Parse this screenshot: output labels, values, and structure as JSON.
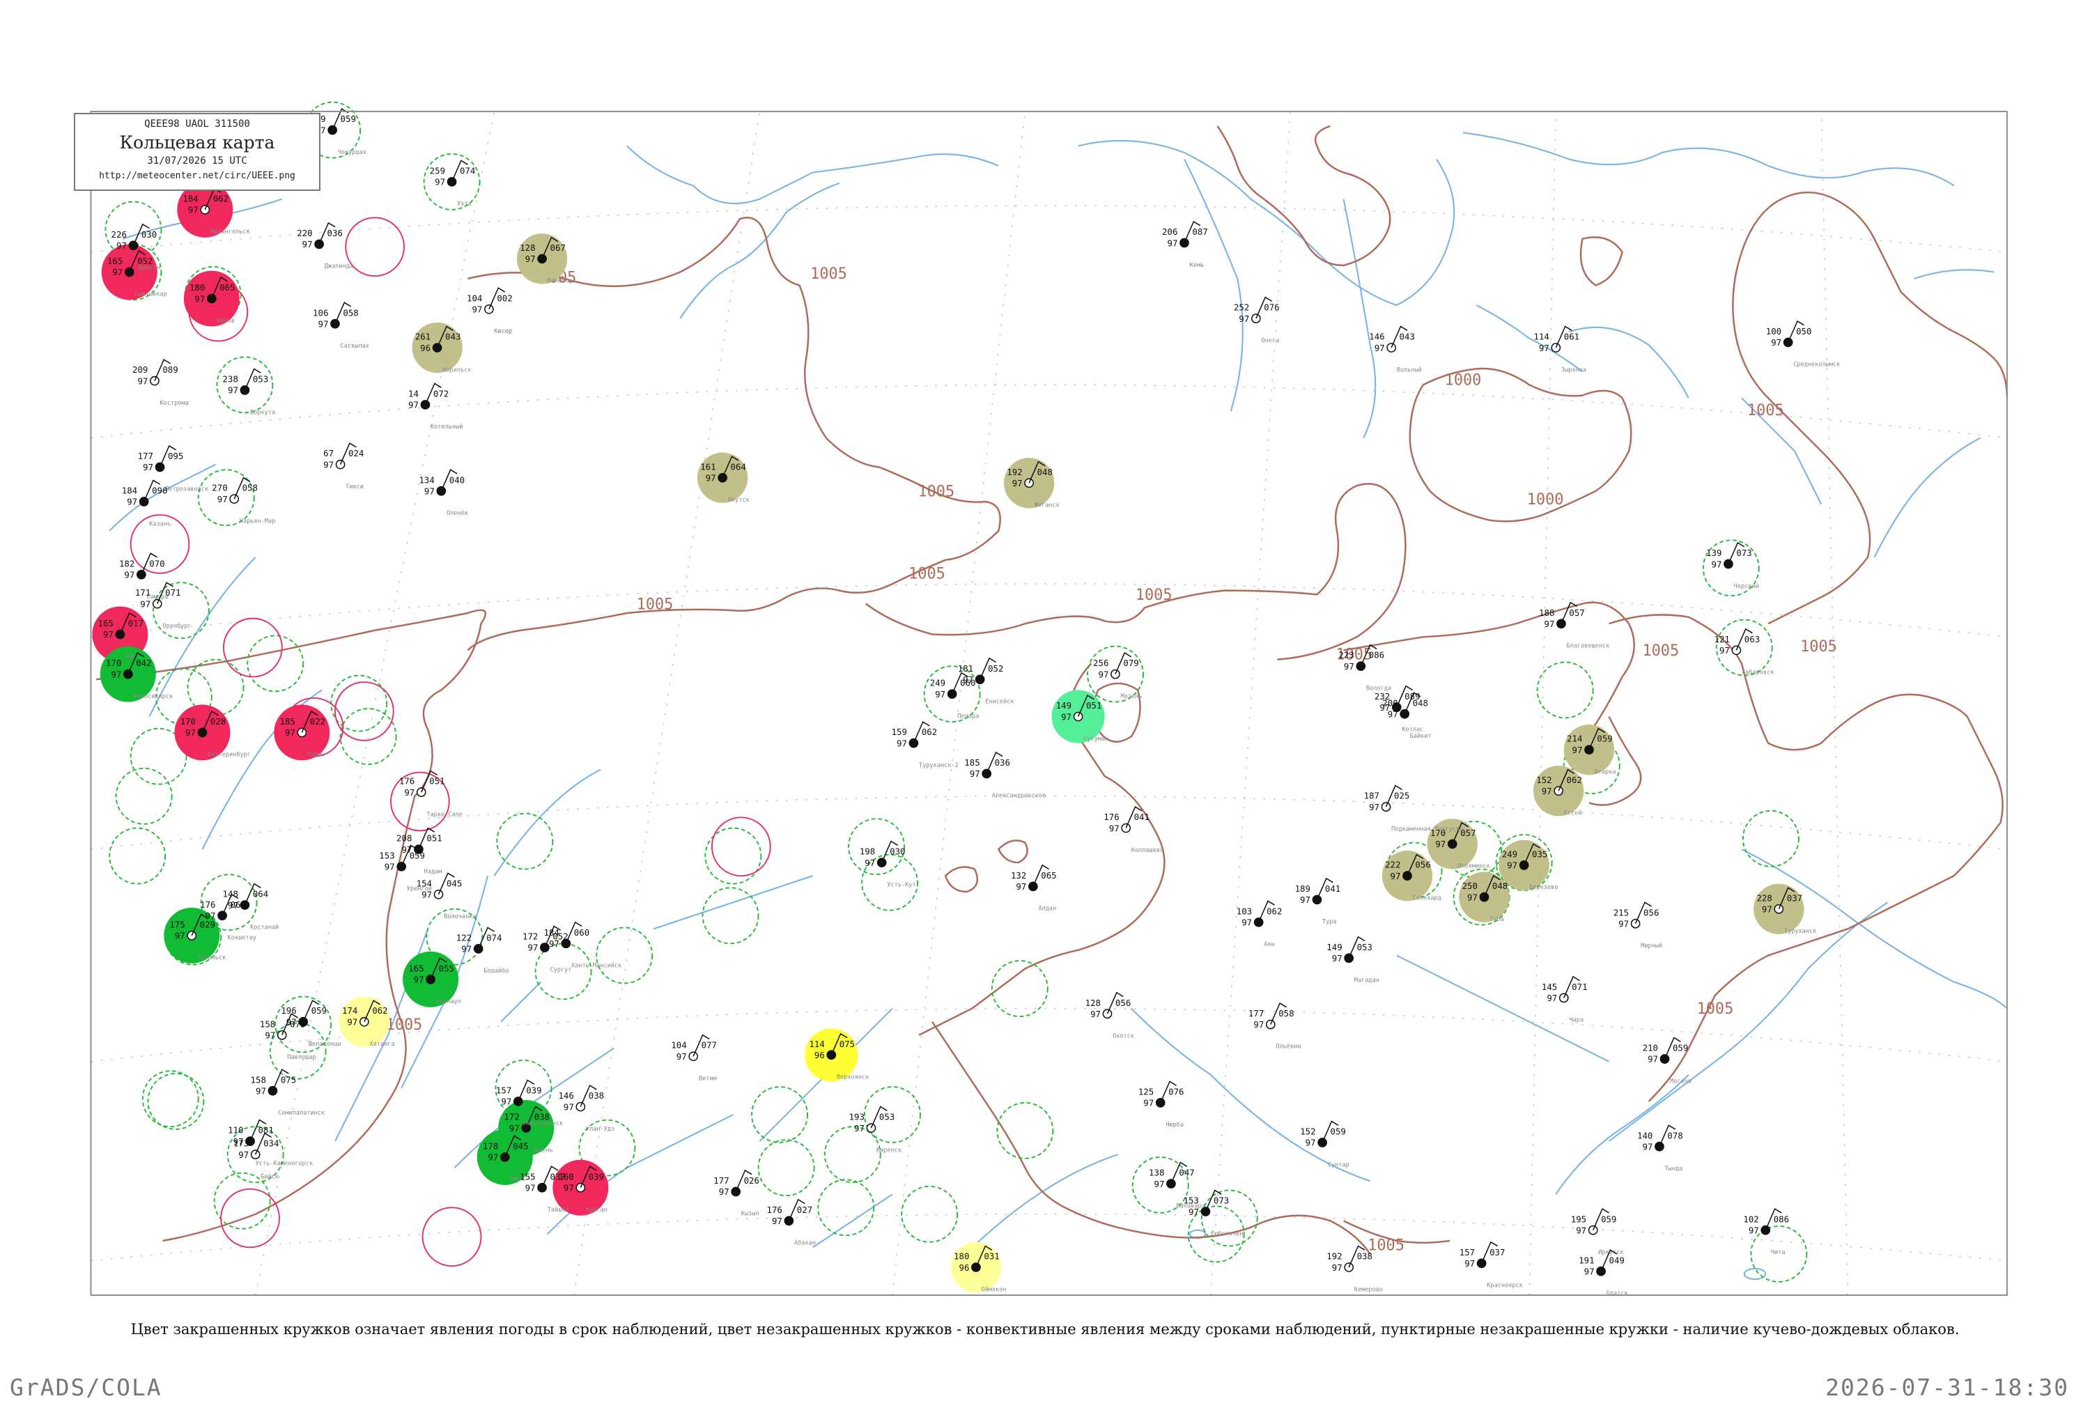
{
  "header": {
    "code": "QEEE98  UAOL  311500",
    "title": "Кольцевая карта",
    "datetime": "31/07/2026 15 UTC",
    "url": "http://meteocenter.net/circ/UEEE.png"
  },
  "caption": "Цвет закрашенных кружков означает явления погоды в срок наблюдений, цвет незакрашенных кружков - конвективные явления между сроками наблюдений, пунктирные незакрашенные кружки - наличие кучево-дождевых облаков.",
  "footer": {
    "left": "GrADS/COLA",
    "right": "2026-07-31-18:30"
  },
  "isobar_labels": [
    "1005",
    "1005",
    "1005",
    "1005",
    "1005",
    "1005",
    "1005",
    "1005",
    "1005",
    "1005",
    "1005",
    "1005",
    "1000",
    "1000",
    "1005"
  ],
  "colors": {
    "frame": "#8a8a8a",
    "isobar": "#b06a5a",
    "river": "#7ab4e6",
    "graticule": "#c8c8c8",
    "cb_dashed": "#22bb33",
    "convective": "#e0306a",
    "fill_red": "#f0285c",
    "fill_green": "#11bb33",
    "fill_lightgreen": "#55ee99",
    "fill_yellow": "#ffff33",
    "fill_paleyellow": "#ffff99",
    "fill_olive": "#c2c08a"
  },
  "stations": [
    {
      "n": "Архангельск",
      "t": "062",
      "p": "97",
      "v": "184",
      "c": "red_fill"
    },
    {
      "n": "Сыктывкар",
      "t": "052",
      "p": "97",
      "v": "165",
      "c": "red_fill"
    },
    {
      "n": "Киров",
      "t": "065",
      "p": "97",
      "v": "180",
      "c": "red_fill"
    },
    {
      "n": "Пермь",
      "t": "022",
      "p": "97",
      "v": "185",
      "c": "red_fill"
    },
    {
      "n": "Екатеринбург",
      "t": "028",
      "p": "97",
      "v": "170",
      "c": "red_fill"
    },
    {
      "n": "Уфа",
      "t": "017",
      "p": "97",
      "v": "165",
      "c": "red_fill"
    },
    {
      "n": "Курган",
      "t": "039",
      "p": "97",
      "v": "160",
      "c": "red_fill"
    },
    {
      "n": "Омск",
      "t": "045",
      "p": "97",
      "v": "178",
      "c": "green_fill"
    },
    {
      "n": "Тюмень",
      "t": "038",
      "p": "97",
      "v": "172",
      "c": "green_fill"
    },
    {
      "n": "Тобольск",
      "t": "029",
      "p": "97",
      "v": "175",
      "c": "green_fill"
    },
    {
      "n": "Новосибирск",
      "t": "042",
      "p": "97",
      "v": "170",
      "c": "green_fill"
    },
    {
      "n": "Барнаул",
      "t": "055",
      "p": "97",
      "v": "165",
      "c": "green_fill"
    },
    {
      "n": "Хатанга",
      "t": "062",
      "p": "97",
      "v": "174",
      "c": "paleyellow_fill"
    },
    {
      "n": "Верхоянск",
      "t": "075",
      "p": "96",
      "v": "114",
      "c": "yellow_fill"
    },
    {
      "n": "Оймякон",
      "t": "031",
      "p": "96",
      "v": "180",
      "c": "paleyellow_fill"
    },
    {
      "n": "Сусуман",
      "t": "051",
      "p": "97",
      "v": "149",
      "c": "lightgreen_fill"
    },
    {
      "n": "Салехард",
      "t": "056",
      "p": "97",
      "v": "222",
      "c": "olive_fill"
    },
    {
      "n": "Игарка",
      "t": "059",
      "p": "97",
      "v": "214",
      "c": "olive_fill"
    },
    {
      "n": "Туруханск",
      "t": "037",
      "p": "97",
      "v": "228",
      "c": "olive_fill"
    },
    {
      "n": "Норильск",
      "t": "043",
      "p": "96",
      "v": "261",
      "c": "olive_fill"
    },
    {
      "n": "Якутск",
      "t": "064",
      "p": "97",
      "v": "161",
      "c": "olive_fill"
    },
    {
      "n": "Жиганск",
      "t": "048",
      "p": "97",
      "v": "192",
      "c": "olive_fill"
    },
    {
      "n": "Вилюйск",
      "t": "067",
      "p": "97",
      "v": "128",
      "c": "olive_fill"
    },
    {
      "n": "Олёкминск",
      "t": "057",
      "p": "97",
      "v": "170",
      "c": "olive_fill"
    },
    {
      "n": "Ессей",
      "t": "062",
      "p": "97",
      "v": "152",
      "c": "olive_fill"
    },
    {
      "n": "Туба",
      "t": "048",
      "p": "97",
      "v": "250",
      "c": "olive_fill"
    },
    {
      "n": "Березово",
      "t": "035",
      "p": "97",
      "v": "249",
      "c": "olive_fill"
    },
    {
      "n": "Мезень",
      "t": "079",
      "p": "97",
      "v": "256",
      "c": "cb_dashed"
    },
    {
      "n": "Печора",
      "t": "060",
      "p": "97",
      "v": "249",
      "c": "cb_dashed"
    },
    {
      "n": "Ухта",
      "t": "074",
      "p": "97",
      "v": "259",
      "c": "cb_dashed"
    },
    {
      "n": "Нарьян-Мар",
      "t": "058",
      "p": "97",
      "v": "270",
      "c": "plain"
    },
    {
      "n": "Воркута",
      "t": "053",
      "p": "97",
      "v": "238",
      "c": "plain"
    },
    {
      "n": "Диксон",
      "t": "030",
      "p": "97",
      "v": "226",
      "c": "plain"
    },
    {
      "n": "Тикси",
      "t": "024",
      "p": "97",
      "v": "67",
      "c": "plain"
    },
    {
      "n": "Котельный",
      "t": "072",
      "p": "97",
      "v": "14",
      "c": "plain"
    },
    {
      "n": "Чокурдах",
      "t": "059",
      "p": "97",
      "v": "79",
      "c": "plain"
    },
    {
      "n": "Зырянка",
      "t": "061",
      "p": "97",
      "v": "114",
      "c": "plain"
    },
    {
      "n": "Среднеколымск",
      "t": "050",
      "p": "97",
      "v": "100",
      "c": "plain"
    },
    {
      "n": "Черский",
      "t": "073",
      "p": "97",
      "v": "139",
      "c": "plain"
    },
    {
      "n": "Хабаровск",
      "t": "063",
      "p": "97",
      "v": "121",
      "c": "plain"
    },
    {
      "n": "Благовещенск",
      "t": "057",
      "p": "97",
      "v": "188",
      "c": "plain"
    },
    {
      "n": "Чита",
      "t": "086",
      "p": "97",
      "v": "102",
      "c": "plain"
    },
    {
      "n": "Иркутск",
      "t": "059",
      "p": "97",
      "v": "195",
      "c": "plain"
    },
    {
      "n": "Братск",
      "t": "049",
      "p": "97",
      "v": "191",
      "c": "plain"
    },
    {
      "n": "Красноярск",
      "t": "037",
      "p": "97",
      "v": "157",
      "c": "plain"
    },
    {
      "n": "Кемерово",
      "t": "038",
      "p": "97",
      "v": "192",
      "c": "plain"
    },
    {
      "n": "Ванавара",
      "t": "047",
      "p": "97",
      "v": "138",
      "c": "plain"
    },
    {
      "n": "Ербогачен",
      "t": "073",
      "p": "97",
      "v": "153",
      "c": "plain"
    },
    {
      "n": "Витим",
      "t": "077",
      "p": "97",
      "v": "104",
      "c": "plain"
    },
    {
      "n": "Бодайбо",
      "t": "074",
      "p": "97",
      "v": "122",
      "c": "plain"
    },
    {
      "n": "Алдан",
      "t": "065",
      "p": "97",
      "v": "132",
      "c": "plain"
    },
    {
      "n": "Охотск",
      "t": "056",
      "p": "97",
      "v": "128",
      "c": "plain"
    },
    {
      "n": "Аян",
      "t": "062",
      "p": "97",
      "v": "103",
      "c": "plain"
    },
    {
      "n": "Магадан",
      "t": "053",
      "p": "97",
      "v": "149",
      "c": "plain"
    },
    {
      "n": "Чара",
      "t": "071",
      "p": "97",
      "v": "145",
      "c": "plain"
    },
    {
      "n": "Могоча",
      "t": "059",
      "p": "97",
      "v": "210",
      "c": "plain"
    },
    {
      "n": "Тында",
      "t": "078",
      "p": "97",
      "v": "140",
      "c": "plain"
    },
    {
      "n": "Ольёкма",
      "t": "058",
      "p": "97",
      "v": "177",
      "c": "plain"
    },
    {
      "n": "Нюрба",
      "t": "076",
      "p": "97",
      "v": "125",
      "c": "plain"
    },
    {
      "n": "Сунтар",
      "t": "059",
      "p": "97",
      "v": "152",
      "c": "plain"
    },
    {
      "n": "Мирный",
      "t": "056",
      "p": "97",
      "v": "215",
      "c": "plain"
    },
    {
      "n": "Тура",
      "t": "041",
      "p": "97",
      "v": "189",
      "c": "plain"
    },
    {
      "n": "Байкит",
      "t": "048",
      "p": "97",
      "v": "200",
      "c": "plain"
    },
    {
      "n": "Подкаменная Тунгуска",
      "t": "025",
      "p": "97",
      "v": "187",
      "c": "plain"
    },
    {
      "n": "Енисейск",
      "t": "052",
      "p": "97",
      "v": "181",
      "c": "plain"
    },
    {
      "n": "Александровское",
      "t": "036",
      "p": "97",
      "v": "185",
      "c": "plain"
    },
    {
      "n": "Колпашево",
      "t": "041",
      "p": "97",
      "v": "176",
      "c": "plain"
    },
    {
      "n": "Ханты-Мансийск",
      "t": "060",
      "p": "97",
      "v": "184",
      "c": "plain"
    },
    {
      "n": "Сургут",
      "t": "052",
      "p": "97",
      "v": "172",
      "c": "plain"
    },
    {
      "n": "Тарко-Сале",
      "t": "051",
      "p": "97",
      "v": "176",
      "c": "plain"
    },
    {
      "n": "Надым",
      "t": "051",
      "p": "97",
      "v": "208",
      "c": "plain"
    },
    {
      "n": "Уренгой",
      "t": "059",
      "p": "97",
      "v": "153",
      "c": "plain"
    },
    {
      "n": "Волочанка",
      "t": "045",
      "p": "97",
      "v": "154",
      "c": "plain"
    },
    {
      "n": "Джалинда",
      "t": "036",
      "p": "97",
      "v": "220",
      "c": "plain"
    },
    {
      "n": "Саскылах",
      "t": "058",
      "p": "97",
      "v": "106",
      "c": "plain"
    },
    {
      "n": "Кюсюр",
      "t": "002",
      "p": "97",
      "v": "104",
      "c": "plain"
    },
    {
      "n": "Оленёк",
      "t": "040",
      "p": "97",
      "v": "134",
      "c": "plain"
    },
    {
      "n": "Шелагонцы",
      "t": "059",
      "p": "97",
      "v": "196",
      "c": "plain"
    },
    {
      "n": "Вольный",
      "t": "043",
      "p": "97",
      "v": "146",
      "c": "plain"
    },
    {
      "n": "Котлас",
      "t": "089",
      "p": "97",
      "v": "232",
      "c": "plain"
    },
    {
      "n": "Вологда",
      "t": "086",
      "p": "97",
      "v": "223",
      "c": "plain"
    },
    {
      "n": "Онега",
      "t": "076",
      "p": "97",
      "v": "252",
      "c": "plain"
    },
    {
      "n": "Кемь",
      "t": "087",
      "p": "97",
      "v": "206",
      "c": "plain"
    },
    {
      "n": "Петрозаводск",
      "t": "095",
      "p": "97",
      "v": "177",
      "c": "plain"
    },
    {
      "n": "Кострома",
      "t": "089",
      "p": "97",
      "v": "209",
      "c": "plain"
    },
    {
      "n": "Казань",
      "t": "090",
      "p": "97",
      "v": "184",
      "c": "plain"
    },
    {
      "n": "Самара",
      "t": "070",
      "p": "97",
      "v": "182",
      "c": "plain"
    },
    {
      "n": "Оренбург",
      "t": "071",
      "p": "97",
      "v": "171",
      "c": "plain"
    },
    {
      "n": "Костанай",
      "t": "064",
      "p": "97",
      "v": "148",
      "c": "plain"
    },
    {
      "n": "Кокшетау",
      "t": "065",
      "p": "97",
      "v": "176",
      "c": "plain"
    },
    {
      "n": "Павлодар",
      "t": "073",
      "p": "97",
      "v": "158",
      "c": "plain"
    },
    {
      "n": "Семипалатинск",
      "t": "075",
      "p": "97",
      "v": "158",
      "c": "plain"
    },
    {
      "n": "Усть-Каменогорск",
      "t": "081",
      "p": "97",
      "v": "110",
      "c": "plain"
    },
    {
      "n": "Бийск",
      "t": "034",
      "p": "97",
      "v": "173",
      "c": "plain"
    },
    {
      "n": "Кызыл",
      "t": "026",
      "p": "97",
      "v": "177",
      "c": "plain"
    },
    {
      "n": "Абакан",
      "t": "027",
      "p": "97",
      "v": "176",
      "c": "plain"
    },
    {
      "n": "Улан-Удэ",
      "t": "038",
      "p": "97",
      "v": "146",
      "c": "plain"
    },
    {
      "n": "Нижнеудинск",
      "t": "039",
      "p": "97",
      "v": "157",
      "c": "plain"
    },
    {
      "n": "Тайшет",
      "t": "037",
      "p": "97",
      "v": "155",
      "c": "plain"
    },
    {
      "n": "Киренск",
      "t": "053",
      "p": "97",
      "v": "193",
      "c": "plain"
    },
    {
      "n": "Усть-Кут",
      "t": "030",
      "p": "97",
      "v": "198",
      "c": "plain"
    },
    {
      "n": "Туруханск-2",
      "t": "062",
      "p": "97",
      "v": "159",
      "c": "plain"
    }
  ]
}
